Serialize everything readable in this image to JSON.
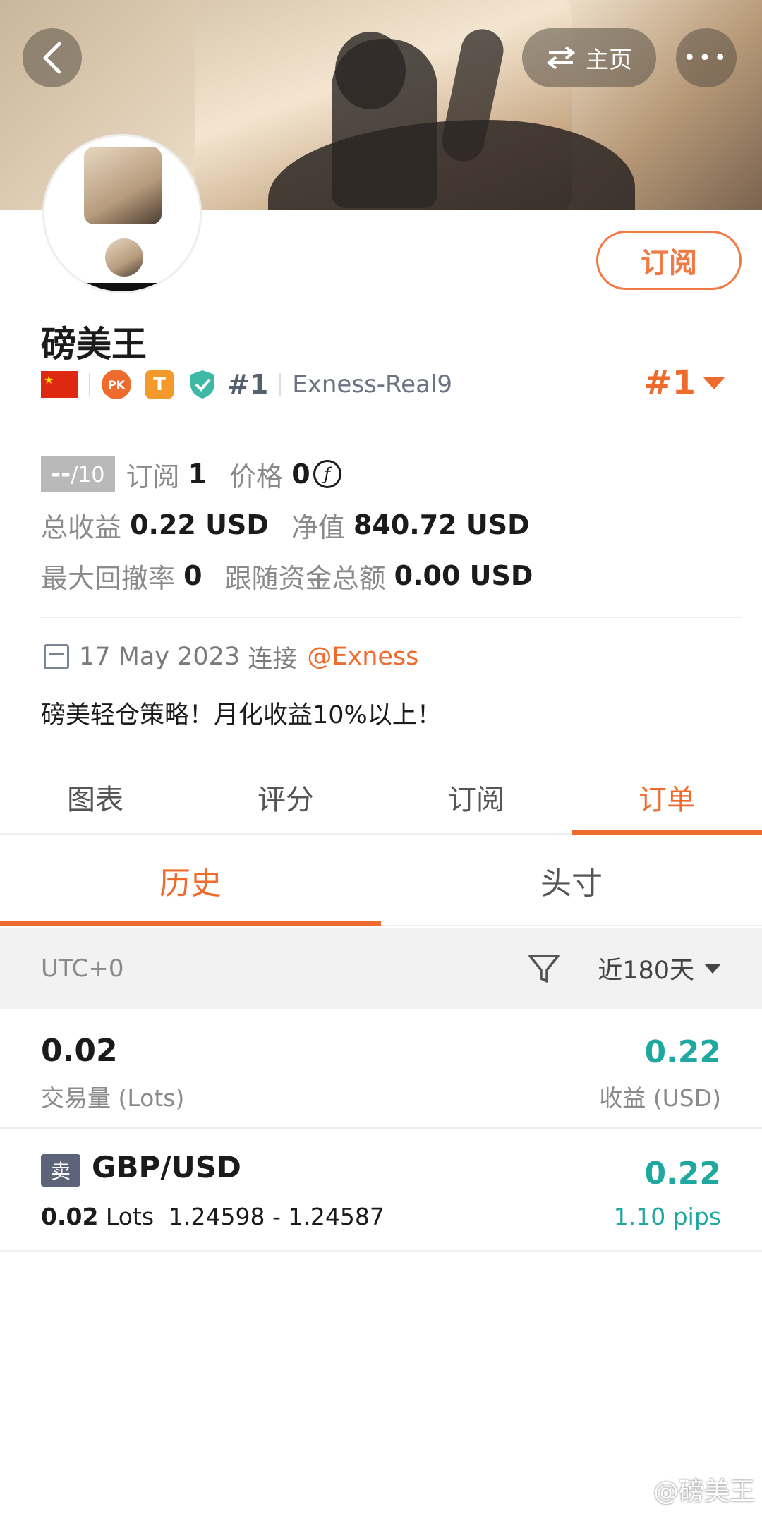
{
  "nav": {
    "home_label": "主页",
    "more_label": "•••"
  },
  "profile": {
    "subscribe_button": "订阅",
    "name": "磅美王",
    "rank_badge": "#1",
    "pk_label": "PK",
    "t_badge": "T",
    "server": "Exness-Real9",
    "rank_big": "#1"
  },
  "stats": {
    "score": "--",
    "score_max": "/10",
    "subscribe_label": "订阅",
    "subscribe_value": "1",
    "price_label": "价格",
    "price_value": "0",
    "coin_symbol": "ƒ",
    "total_profit_label": "总收益",
    "total_profit_value": "0.22 USD",
    "equity_label": "净值",
    "equity_value": "840.72 USD",
    "max_drawdown_label": "最大回撤率",
    "max_drawdown_value": "0",
    "follow_funds_label": "跟随资金总额",
    "follow_funds_value": "0.00 USD"
  },
  "connect": {
    "date": "17 May 2023",
    "label": "连接",
    "broker": "@Exness"
  },
  "description": "磅美轻仓策略！月化收益10%以上！",
  "tabs": [
    {
      "label": "图表"
    },
    {
      "label": "评分"
    },
    {
      "label": "订阅"
    },
    {
      "label": "订单"
    }
  ],
  "subtabs": [
    {
      "label": "历史"
    },
    {
      "label": "头寸"
    }
  ],
  "filter": {
    "timezone": "UTC+0",
    "range": "近180天"
  },
  "summary": {
    "lots_value": "0.02",
    "lots_label": "交易量 (Lots)",
    "profit_value": "0.22",
    "profit_label": "收益 (USD)"
  },
  "orders": [
    {
      "side": "卖",
      "pair": "GBP/USD",
      "lots": "0.02",
      "lots_unit": "Lots",
      "prices": "1.24598 - 1.24587",
      "profit": "0.22",
      "pips": "1.10 pips"
    }
  ],
  "watermark": "@磅美王",
  "colors": {
    "accent": "#ef6b2d",
    "profit": "#20a8a0",
    "muted": "#8a8a8a"
  }
}
